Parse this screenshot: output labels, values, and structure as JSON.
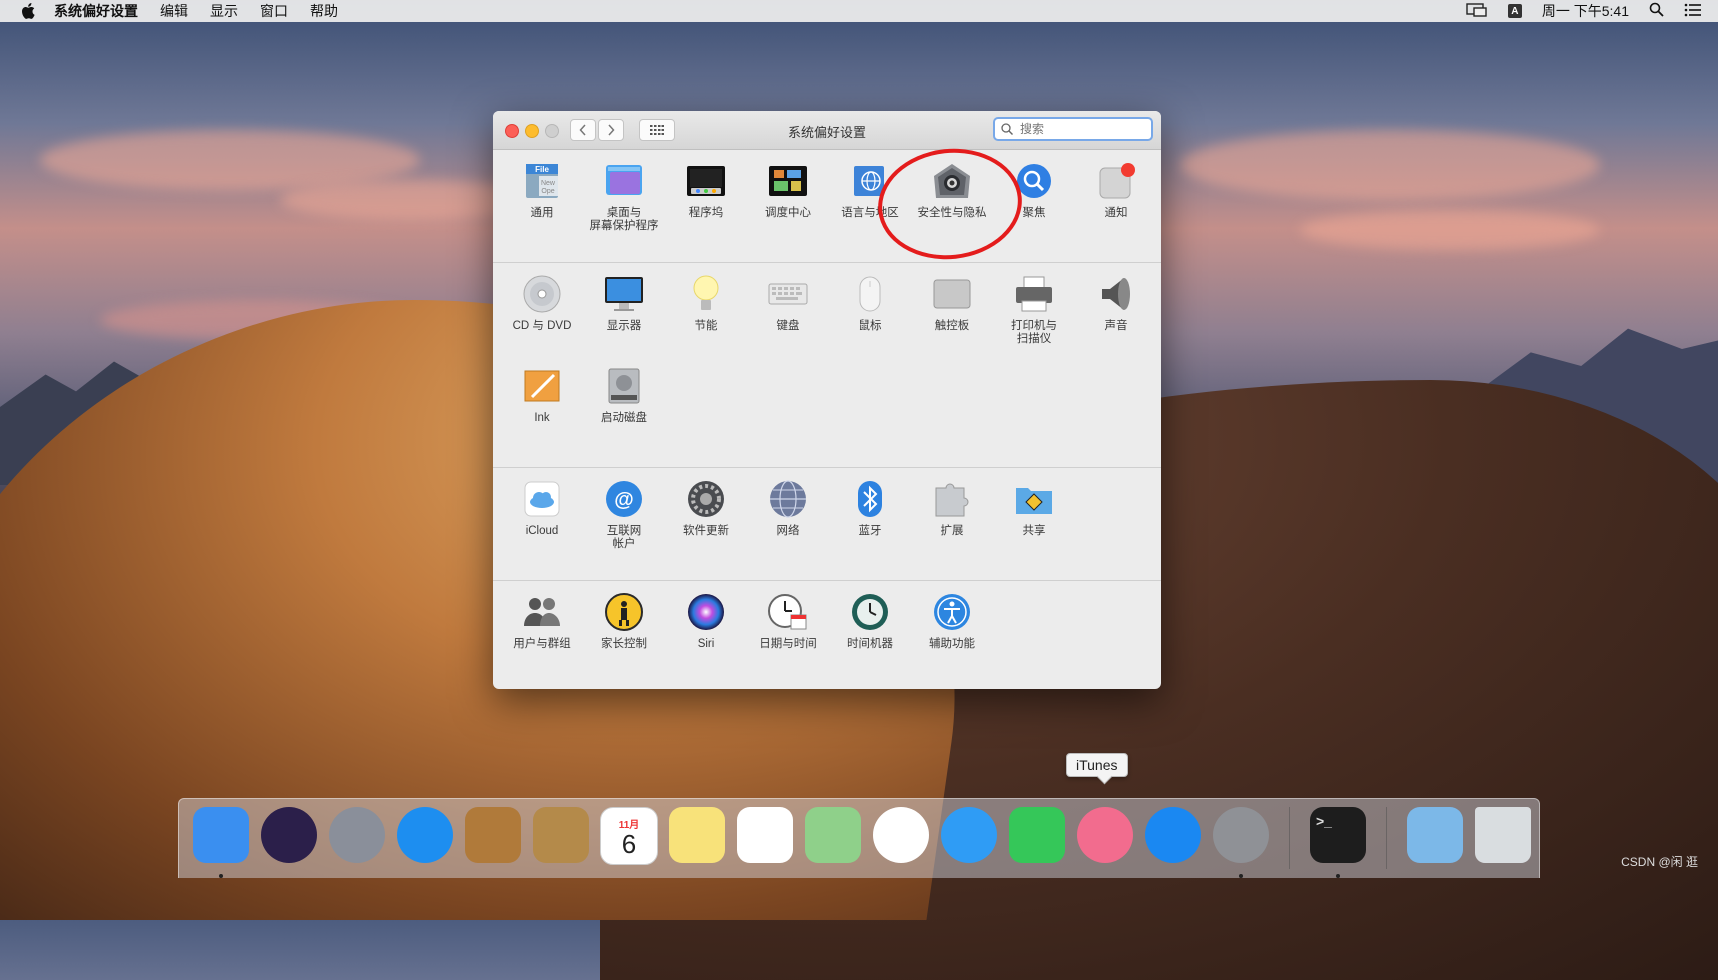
{
  "menubar": {
    "app_name": "系统偏好设置",
    "items": [
      "编辑",
      "显示",
      "窗口",
      "帮助"
    ],
    "clock": "周一 下午5:41",
    "input_source": "A"
  },
  "window": {
    "title": "系统偏好设置",
    "search_placeholder": "搜索"
  },
  "sections": [
    [
      {
        "label": "通用",
        "icon": "general-icon"
      },
      {
        "label": "桌面与\n屏幕保护程序",
        "icon": "desktop-screensaver-icon"
      },
      {
        "label": "程序坞",
        "icon": "dock-icon"
      },
      {
        "label": "调度中心",
        "icon": "mission-control-icon"
      },
      {
        "label": "语言与地区",
        "icon": "language-region-icon"
      },
      {
        "label": "安全性与隐私",
        "icon": "security-privacy-icon"
      },
      {
        "label": "聚焦",
        "icon": "spotlight-icon"
      },
      {
        "label": "通知",
        "icon": "notifications-icon"
      }
    ],
    [
      {
        "label": "CD 与 DVD",
        "icon": "cd-dvd-icon"
      },
      {
        "label": "显示器",
        "icon": "displays-icon"
      },
      {
        "label": "节能",
        "icon": "energy-saver-icon"
      },
      {
        "label": "键盘",
        "icon": "keyboard-icon"
      },
      {
        "label": "鼠标",
        "icon": "mouse-icon"
      },
      {
        "label": "触控板",
        "icon": "trackpad-icon"
      },
      {
        "label": "打印机与\n扫描仪",
        "icon": "printers-scanners-icon"
      },
      {
        "label": "声音",
        "icon": "sound-icon"
      },
      {
        "label": "Ink",
        "icon": "ink-icon"
      },
      {
        "label": "启动磁盘",
        "icon": "startup-disk-icon"
      }
    ],
    [
      {
        "label": "iCloud",
        "icon": "icloud-icon"
      },
      {
        "label": "互联网\n帐户",
        "icon": "internet-accounts-icon"
      },
      {
        "label": "软件更新",
        "icon": "software-update-icon"
      },
      {
        "label": "网络",
        "icon": "network-icon"
      },
      {
        "label": "蓝牙",
        "icon": "bluetooth-icon"
      },
      {
        "label": "扩展",
        "icon": "extensions-icon"
      },
      {
        "label": "共享",
        "icon": "sharing-icon"
      }
    ],
    [
      {
        "label": "用户与群组",
        "icon": "users-groups-icon"
      },
      {
        "label": "家长控制",
        "icon": "parental-controls-icon"
      },
      {
        "label": "Siri",
        "icon": "siri-icon"
      },
      {
        "label": "日期与时间",
        "icon": "date-time-icon"
      },
      {
        "label": "时间机器",
        "icon": "time-machine-icon"
      },
      {
        "label": "辅助功能",
        "icon": "accessibility-icon"
      }
    ]
  ],
  "tooltip": "iTunes",
  "dock": [
    {
      "name": "finder-icon",
      "color": "#3a8ff0",
      "running": true
    },
    {
      "name": "siri-icon",
      "color": "#2b1f4a",
      "running": false
    },
    {
      "name": "launchpad-icon",
      "color": "#8a8f9a",
      "running": false
    },
    {
      "name": "safari-icon",
      "color": "#1d8ef0",
      "running": false
    },
    {
      "name": "mail-icon",
      "color": "#b07a3a",
      "running": false
    },
    {
      "name": "contacts-icon",
      "color": "#b48a4a",
      "running": false
    },
    {
      "name": "calendar-icon",
      "color": "#ffffff",
      "running": false
    },
    {
      "name": "notes-icon",
      "color": "#f8e27a",
      "running": false
    },
    {
      "name": "reminders-icon",
      "color": "#ffffff",
      "running": false
    },
    {
      "name": "maps-icon",
      "color": "#8fd08a",
      "running": false
    },
    {
      "name": "photos-icon",
      "color": "#ffffff",
      "running": false
    },
    {
      "name": "messages-icon",
      "color": "#2f9cf5",
      "running": false
    },
    {
      "name": "facetime-icon",
      "color": "#35c759",
      "running": false
    },
    {
      "name": "itunes-icon",
      "color": "#f26c8e",
      "running": false
    },
    {
      "name": "app-store-icon",
      "color": "#1a88f2",
      "running": false
    },
    {
      "name": "system-preferences-icon",
      "color": "#8f9196",
      "running": true
    },
    {
      "name": "terminal-icon",
      "color": "#1d1d1d",
      "running": true
    },
    {
      "name": "downloads-folder-icon",
      "color": "#7cb8e8",
      "running": false
    },
    {
      "name": "trash-icon",
      "color": "#d9dde0",
      "running": false
    }
  ],
  "calendar_month": "11月",
  "calendar_day": "6",
  "watermark": "CSDN @闲 逛"
}
